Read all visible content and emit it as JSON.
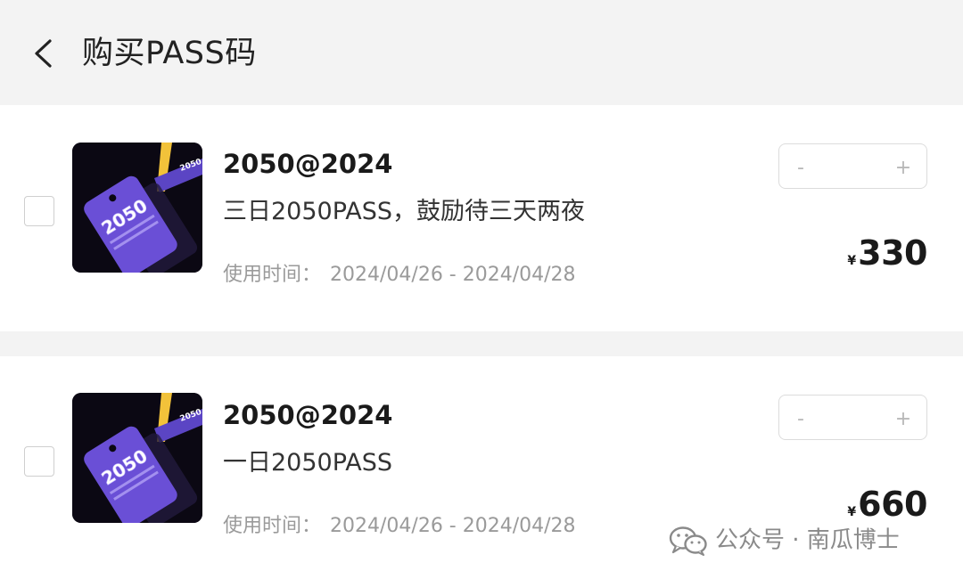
{
  "header": {
    "back_icon": "chevron-left-icon",
    "title": "购买PASS码"
  },
  "items": [
    {
      "image": "2050-pass-tag-thumbnail",
      "tag_text": "2050",
      "title": "2050@2024",
      "description": "三日2050PASS，鼓励待三天两夜",
      "time_label": "使用时间：",
      "time_value": "2024/04/26 - 2024/04/28",
      "stepper": {
        "minus": "-",
        "plus": "+",
        "quantity": ""
      },
      "price": {
        "currency": "¥",
        "amount": "330"
      },
      "selected": false
    },
    {
      "image": "2050-pass-tag-thumbnail",
      "tag_text": "2050",
      "title": "2050@2024",
      "description": "一日2050PASS",
      "time_label": "使用时间：",
      "time_value": "2024/04/26 - 2024/04/28",
      "stepper": {
        "minus": "-",
        "plus": "+",
        "quantity": ""
      },
      "price": {
        "currency": "¥",
        "amount": "660"
      },
      "selected": false
    }
  ],
  "watermark": {
    "icon": "wechat-icon",
    "text": "公众号 · 南瓜博士"
  },
  "colors": {
    "page_background": "#f3f3f3",
    "card_background": "#ffffff",
    "tag_purple": "#6a4fd6",
    "lanyard_yellow": "#f2c23a"
  }
}
